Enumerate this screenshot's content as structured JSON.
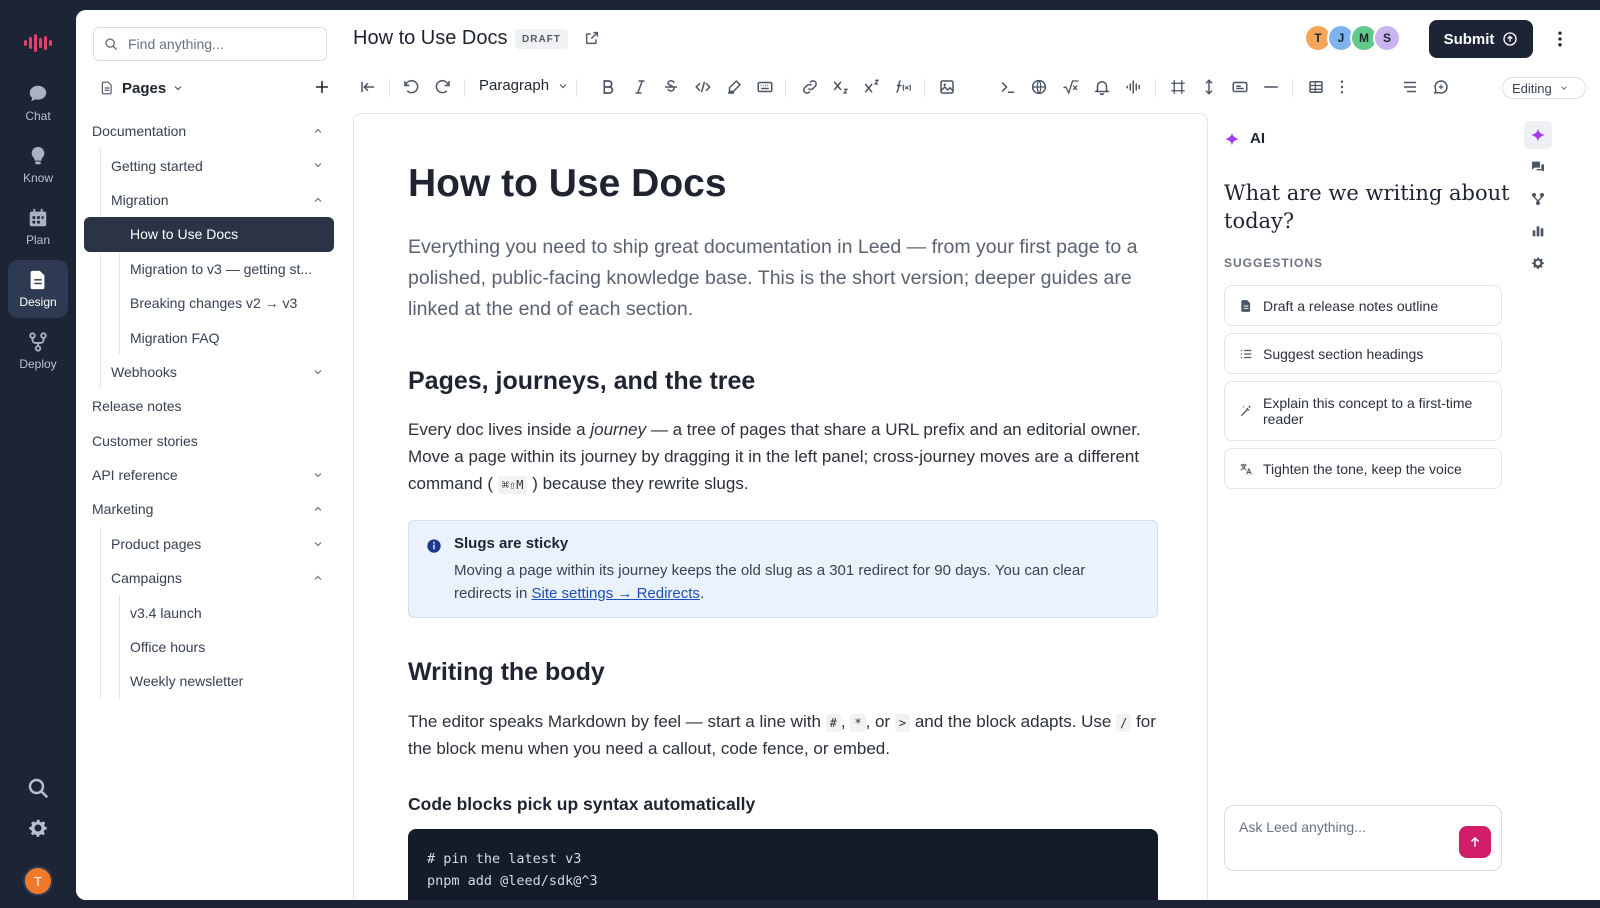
{
  "rail": {
    "items": [
      {
        "label": "Chat",
        "icon": "chat-bubble-icon"
      },
      {
        "label": "Know",
        "icon": "lightbulb-icon"
      },
      {
        "label": "Plan",
        "icon": "calendar-icon"
      },
      {
        "label": "Design",
        "icon": "document-icon",
        "active": true
      },
      {
        "label": "Deploy",
        "icon": "deploy-icon"
      }
    ],
    "avatar": "T"
  },
  "sidebar": {
    "search_placeholder": "Find anything...",
    "pages_label": "Pages",
    "tree": [
      {
        "label": "Documentation",
        "level": 0,
        "caret": "up"
      },
      {
        "label": "Getting started",
        "level": 1,
        "caret": "down"
      },
      {
        "label": "Migration",
        "level": 1,
        "caret": "up"
      },
      {
        "label": "How to Use Docs",
        "level": 2,
        "active": true
      },
      {
        "label": "Migration to v3 — getting st...",
        "level": 2
      },
      {
        "label": "Breaking changes v2 → v3",
        "level": 2
      },
      {
        "label": "Migration FAQ",
        "level": 2
      },
      {
        "label": "Webhooks",
        "level": 1,
        "caret": "down"
      },
      {
        "label": "Release notes",
        "level": 0
      },
      {
        "label": "Customer stories",
        "level": 0
      },
      {
        "label": "API reference",
        "level": 0,
        "caret": "down"
      },
      {
        "label": "Marketing",
        "level": 0,
        "caret": "up"
      },
      {
        "label": "Product pages",
        "level": 1,
        "caret": "down"
      },
      {
        "label": "Campaigns",
        "level": 1,
        "caret": "up"
      },
      {
        "label": "v3.4 launch",
        "level": 2
      },
      {
        "label": "Office hours",
        "level": 2
      },
      {
        "label": "Weekly newsletter",
        "level": 2
      }
    ]
  },
  "header": {
    "title": "How to Use Docs",
    "status_badge": "DRAFT",
    "avatars": [
      {
        "initial": "T",
        "color": "#f6a65a"
      },
      {
        "initial": "J",
        "color": "#7fb3ee"
      },
      {
        "initial": "M",
        "color": "#62c98a"
      },
      {
        "initial": "S",
        "color": "#c9b4f0"
      }
    ],
    "submit_label": "Submit"
  },
  "toolbar": {
    "block_type": "Paragraph",
    "mode": "Editing"
  },
  "doc": {
    "title": "How to Use Docs",
    "lede": "Everything you need to ship great documentation in Leed — from your first page to a polished, public-facing knowledge base. This is the short version; deeper guides are linked at the end of each section.",
    "s1_heading": "Pages, journeys, and the tree",
    "s1_p_a": "Every doc lives inside a ",
    "s1_p_em": "journey",
    "s1_p_b": " — a tree of pages that share a URL prefix and an editorial owner. Move a page within its journey by dragging it in the left panel; cross-journey moves are a different command (",
    "s1_p_kbd": "⌘⇧M",
    "s1_p_c": ") because they rewrite slugs.",
    "callout_title": "Slugs are sticky",
    "callout_body": "Moving a page within its journey keeps the old slug as a 301 redirect for 90 days. You can clear redirects in ",
    "callout_link": "Site settings → Redirects",
    "callout_end": ".",
    "s2_heading": "Writing the body",
    "s2_p_a": "The editor speaks Markdown by feel — start a line with ",
    "s2_k1": "#",
    "s2_sep1": ", ",
    "s2_k2": "*",
    "s2_sep2": ", or ",
    "s2_k3": ">",
    "s2_p_b": " and the block adapts. Use ",
    "s2_k4": "/",
    "s2_p_c": " for the block menu when you need a callout, code fence, or embed.",
    "s3_heading": "Code blocks pick up syntax automatically",
    "code_line1": "# pin the latest v3",
    "code_line2": "pnpm add @leed/sdk@^3"
  },
  "ai": {
    "label": "AI",
    "question": "What are we writing about today?",
    "suggestions_label": "SUGGESTIONS",
    "suggestions": [
      {
        "label": "Draft a release notes outline",
        "icon": "document-icon"
      },
      {
        "label": "Suggest section headings",
        "icon": "list-icon"
      },
      {
        "label": "Explain this concept to a first-time reader",
        "icon": "magic-wand-icon"
      },
      {
        "label": "Tighten the tone, keep the voice",
        "icon": "translate-icon"
      }
    ],
    "ask_placeholder": "Ask Leed anything..."
  },
  "colors": {
    "rail_bg": "#1c2436",
    "active_item": "#2a3446",
    "accent_pink": "#d21e6a",
    "ai_sparkle": "#a23cf0",
    "callout_bg": "#eaf2fd"
  }
}
